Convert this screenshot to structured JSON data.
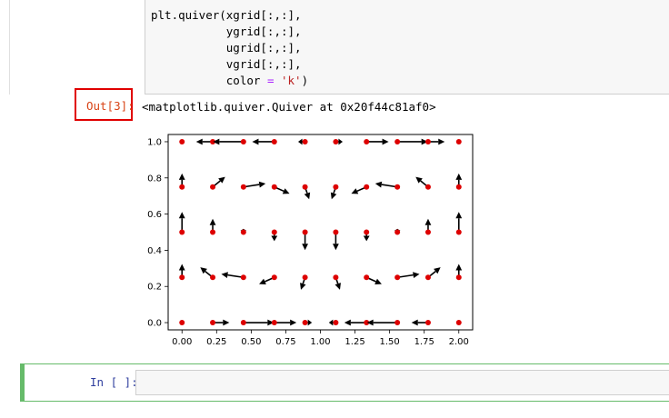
{
  "code": {
    "lines": [
      {
        "pre": "plt.quiver(xgrid[:,:],"
      },
      {
        "pre": "           ygrid[:,:],"
      },
      {
        "pre": "           ugrid[:,:],"
      },
      {
        "pre": "           vgrid[:,:],"
      },
      {
        "pre": "           color ",
        "op": "=",
        "mid": " ",
        "str": "'k'",
        "post": ")"
      }
    ]
  },
  "output": {
    "prompt": "Out[3]:",
    "repr": "<matplotlib.quiver.Quiver at 0x20f44c81af0>"
  },
  "next_cell": {
    "prompt": "In [ ]:"
  },
  "colors": {
    "point": "#dd0000",
    "arrow": "#000000",
    "out_prompt": "#d84315",
    "in_prompt": "#303f9f",
    "highlight_box": "#e00000"
  },
  "chart_data": {
    "type": "scatter",
    "xlim": [
      -0.1,
      2.1
    ],
    "ylim": [
      -0.04,
      1.04
    ],
    "xticks": [
      "0.00",
      "0.25",
      "0.50",
      "0.75",
      "1.00",
      "1.25",
      "1.50",
      "1.75",
      "2.00"
    ],
    "xtick_values": [
      0,
      0.25,
      0.5,
      0.75,
      1.0,
      1.25,
      1.5,
      1.75,
      2.0
    ],
    "yticks": [
      "0.0",
      "0.2",
      "0.4",
      "0.6",
      "0.8",
      "1.0"
    ],
    "ytick_values": [
      0,
      0.2,
      0.4,
      0.6,
      0.8,
      1.0
    ],
    "x": [
      0,
      0.222,
      0.444,
      0.667,
      0.889,
      1.111,
      1.333,
      1.556,
      1.778,
      2.0
    ],
    "y": [
      0,
      0.25,
      0.5,
      0.75,
      1.0
    ],
    "u": [
      [
        0,
        0.12,
        0.22,
        0.16,
        0.05,
        -0.05,
        -0.16,
        -0.22,
        -0.12,
        0
      ],
      [
        0,
        -0.09,
        -0.16,
        -0.11,
        -0.03,
        0.03,
        0.11,
        0.16,
        0.09,
        0
      ],
      [
        0,
        0,
        0,
        0,
        0,
        0,
        0,
        0,
        0,
        0
      ],
      [
        0,
        0.09,
        0.16,
        0.11,
        0.03,
        -0.03,
        -0.11,
        -0.16,
        -0.09,
        0
      ],
      [
        0,
        -0.12,
        -0.22,
        -0.16,
        -0.05,
        0.05,
        0.16,
        0.22,
        0.12,
        0
      ]
    ],
    "v": [
      [
        0,
        0,
        0,
        0,
        0,
        0,
        0,
        0,
        0,
        0
      ],
      [
        0.12,
        0.09,
        0.03,
        -0.06,
        -0.11,
        -0.11,
        -0.06,
        0.03,
        0.09,
        0.12
      ],
      [
        0.18,
        0.12,
        0.03,
        -0.08,
        -0.16,
        -0.16,
        -0.08,
        0.03,
        0.12,
        0.18
      ],
      [
        0.12,
        0.09,
        0.03,
        -0.06,
        -0.11,
        -0.11,
        -0.06,
        0.03,
        0.09,
        0.12
      ],
      [
        0,
        0,
        0,
        0,
        0,
        0,
        0,
        0,
        0,
        0
      ]
    ]
  }
}
